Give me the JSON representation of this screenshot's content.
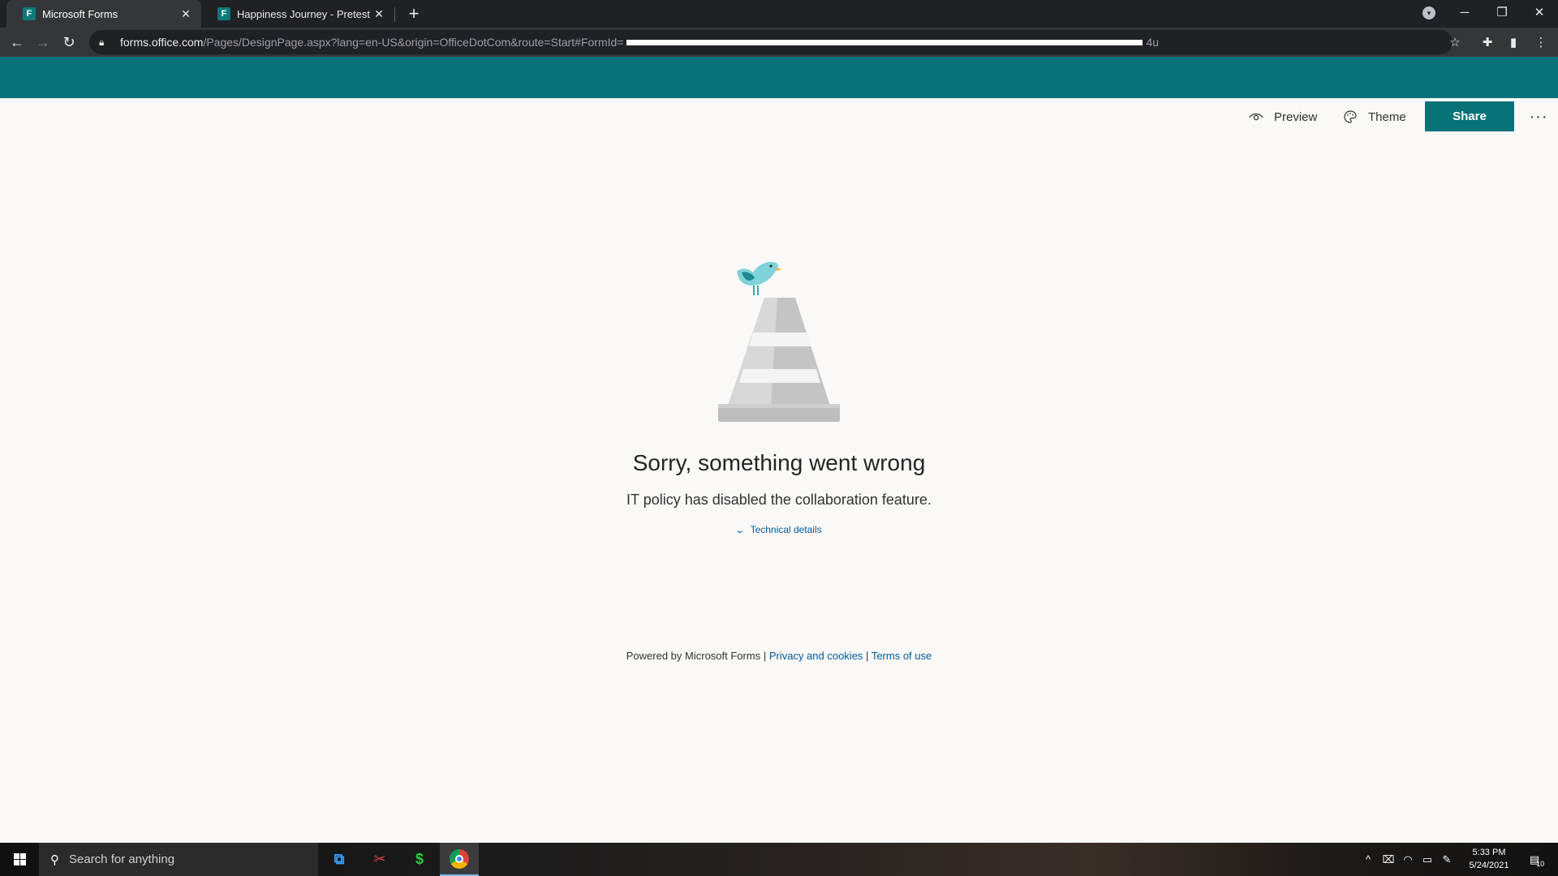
{
  "browser": {
    "tabs": [
      {
        "title": "Microsoft Forms",
        "favicon": "F",
        "active": true
      },
      {
        "title": "Happiness Journey - Pretest",
        "favicon": "F",
        "active": false
      }
    ],
    "new_tab": "+",
    "url": {
      "host": "forms.office.com",
      "path": "/Pages/DesignPage.aspx?lang=en-US&origin=OfficeDotCom&route=Start#FormId=",
      "tail": "4u"
    },
    "colors": {
      "tabstrip": "#202124",
      "toolbar": "#35363a"
    }
  },
  "forms": {
    "header_color": "#077278",
    "commands": {
      "preview": "Preview",
      "theme": "Theme",
      "share": "Share",
      "more": "···"
    },
    "error": {
      "title": "Sorry, something went wrong",
      "message": "IT policy has disabled the collaboration feature.",
      "details_link": "Technical details"
    },
    "footer": {
      "powered_by": "Powered by Microsoft Forms",
      "sep1": " | ",
      "privacy": "Privacy and cookies",
      "sep2": " | ",
      "terms": "Terms of use"
    }
  },
  "taskbar": {
    "search_placeholder": "Search for anything",
    "clock_time": "5:33 PM",
    "clock_date": "5/24/2021",
    "notification_count": "10"
  }
}
